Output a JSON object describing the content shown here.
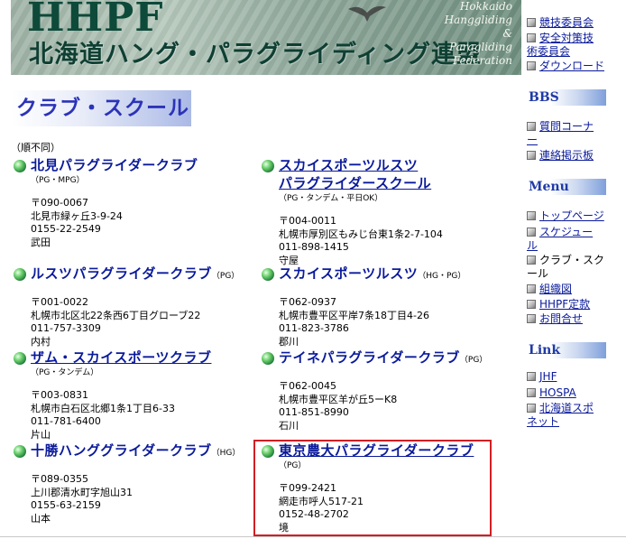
{
  "banner": {
    "title_en": "HHPF",
    "title_jp": "北海道ハング・パラグライディング連盟",
    "script_lines": [
      "Hokkaido",
      "Hanggliding",
      "&",
      "Paragliding",
      "Federation"
    ]
  },
  "page_title": "クラブ・スクール",
  "order_note": "（順不同）",
  "clubs_left": [
    {
      "name": "北見パラグライダークラブ",
      "inline_tag": "",
      "tag": "（PG・MPG）",
      "lines": [
        "〒090-0067",
        "北見市緑ヶ丘3-9-24",
        "0155-22-2549",
        "武田"
      ]
    },
    {
      "name": "ルスツパラグライダークラブ",
      "inline_tag": "（PG）",
      "tag": "",
      "lines": [
        "〒001-0022",
        "札幌市北区北22条西6丁目グローブ22",
        "011-757-3309",
        "内村"
      ]
    },
    {
      "name": "ザム・スカイスポーツクラブ",
      "inline_tag": "",
      "tag": "（PG・タンデム）",
      "lines": [
        "〒003-0831",
        "札幌市白石区北郷1条1丁目6-33",
        "011-781-6400",
        "片山"
      ]
    },
    {
      "name": "十勝ハンググライダークラブ",
      "inline_tag": "（HG）",
      "tag": "",
      "lines": [
        "〒089-0355",
        "上川郡清水町字旭山31",
        "0155-63-2159",
        "山本"
      ]
    }
  ],
  "clubs_right": [
    {
      "name": "スカイスポーツルスツ",
      "name2": "パラグライダースクール",
      "inline_tag": "",
      "tag": "（PG・タンデム・平日OK）",
      "lines": [
        "〒004-0011",
        "札幌市厚別区もみじ台東1条2-7-104",
        "011-898-1415",
        "守屋"
      ]
    },
    {
      "name": "スカイスポーツルスツ",
      "inline_tag": "（HG・PG）",
      "tag": "",
      "lines": [
        "〒062-0937",
        "札幌市豊平区平岸7条18丁目4-26",
        "011-823-3786",
        "郡川"
      ]
    },
    {
      "name": "テイネパラグライダークラブ",
      "inline_tag": "（PG）",
      "tag": "",
      "lines": [
        "〒062-0045",
        "札幌市豊平区羊が丘5ーK8",
        "011-851-8990",
        "石川"
      ]
    },
    {
      "name": "東京農大パラグライダークラブ",
      "inline_tag": "",
      "tag": "（PG）",
      "lines": [
        "〒099-2421",
        "網走市呼人517-21",
        "0152-48-2702",
        "境"
      ]
    }
  ],
  "sidebar": {
    "top_links": [
      "競技委員会",
      "安全対策技",
      "術委員会",
      "ダウンロード"
    ],
    "bbs_head": "BBS",
    "bbs_links": [
      "質問コーナ",
      "ー",
      "連絡掲示板"
    ],
    "menu_head": "Menu",
    "menu_links": [
      "トップページ",
      "スケジュー",
      "ル",
      "クラブ・スク",
      "ール",
      "組織図",
      "HHPF定款",
      "お問合せ"
    ],
    "link_head": "Link",
    "ext_links": [
      "JHF",
      "HOSPA",
      "北海道スポ",
      "ネット"
    ]
  }
}
